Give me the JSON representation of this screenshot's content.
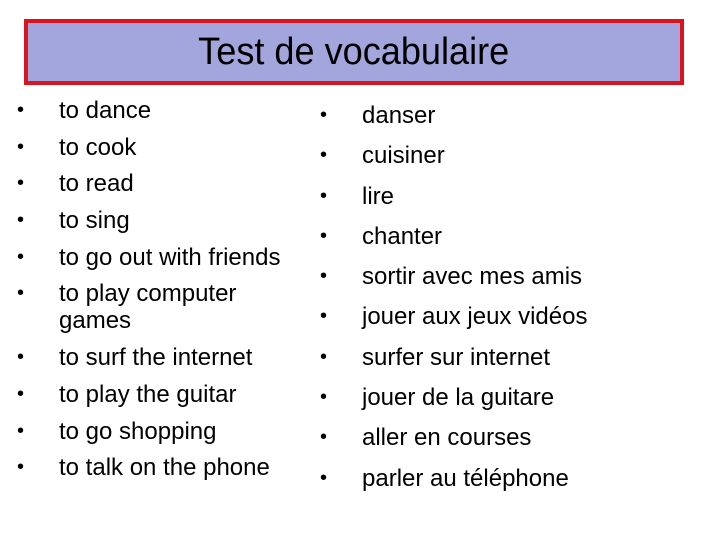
{
  "slide": {
    "title": "Test de vocabulaire",
    "colors": {
      "title_fill": "#a3a5dd",
      "title_border": "#d9141e",
      "text": "#000000",
      "background": "#ffffff"
    },
    "bullet_glyph": "•",
    "english_items": [
      "to dance",
      "to cook",
      "to read",
      "to sing",
      "to go out with friends",
      "to play computer games",
      "to surf the internet",
      "to play the guitar",
      "to go shopping",
      "to talk on the phone"
    ],
    "french_items": [
      "danser",
      "cuisiner",
      "lire",
      "chanter",
      "sortir avec mes amis",
      "jouer aux jeux vidéos",
      "surfer sur internet",
      "jouer de la guitare",
      "aller en courses",
      "parler au téléphone"
    ]
  }
}
